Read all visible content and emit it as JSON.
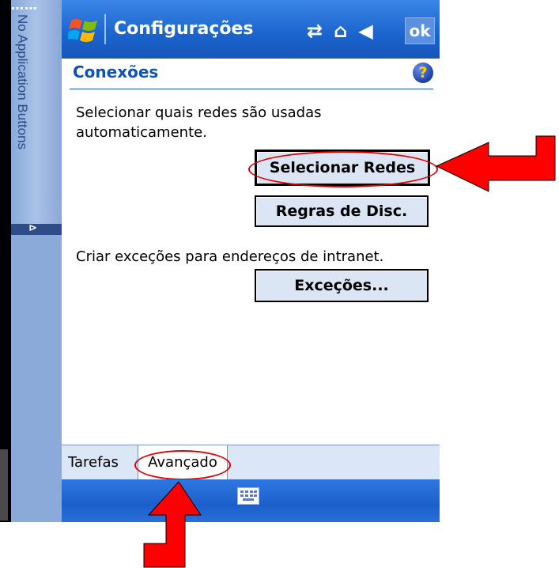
{
  "app": {
    "side_strip_text": "No Application Buttons",
    "title": "Configurações",
    "ok_label": "ok",
    "status_icons": [
      "connectivity-icon",
      "signal-off-icon",
      "volume-icon"
    ]
  },
  "page": {
    "heading": "Conexões",
    "help": "?",
    "description1": "Selecionar quais redes são usadas automaticamente.",
    "description2": "Criar exceções para endereços de intranet."
  },
  "buttons": {
    "select_networks": "Selecionar Redes",
    "disconnect_rules": "Regras de Disc.",
    "exceptions": "Exceções..."
  },
  "tabs": [
    {
      "label": "Tarefas"
    },
    {
      "label": "Avançado",
      "selected": true
    }
  ],
  "colors": {
    "accent": "#1656b8",
    "annotation": "#e00000"
  }
}
